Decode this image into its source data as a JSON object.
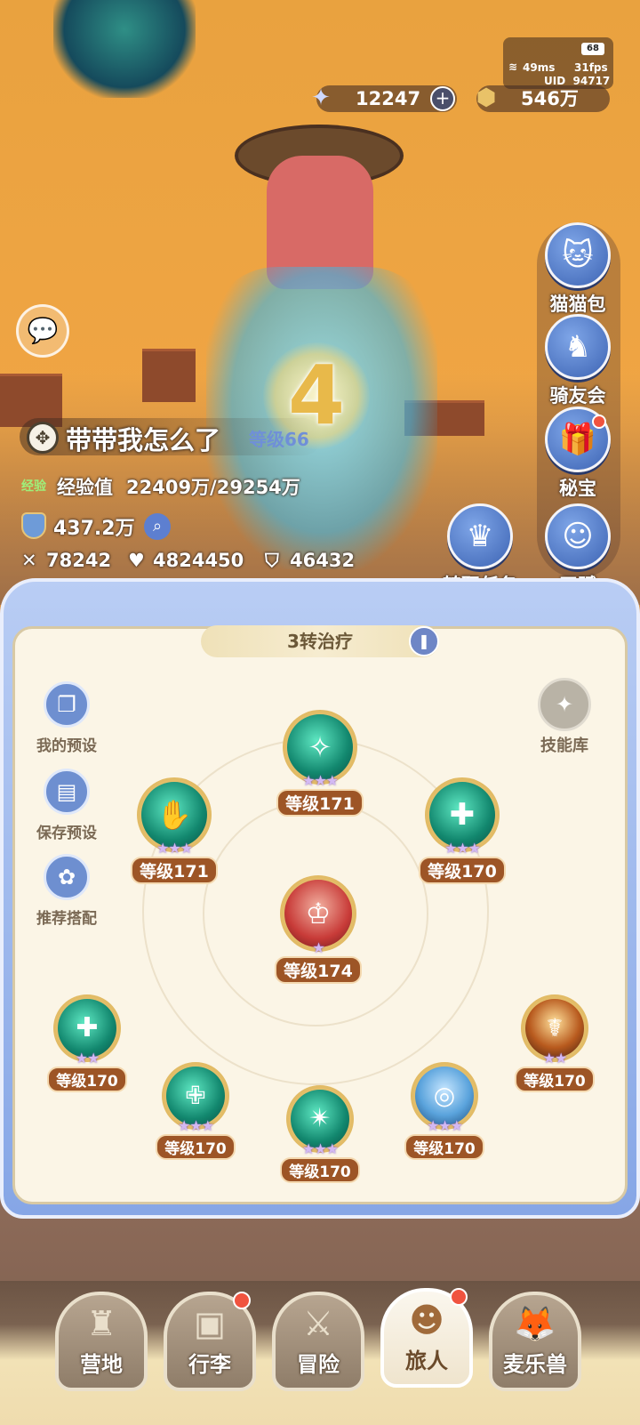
{
  "status": {
    "battery": "68",
    "ping": "49ms",
    "fps": "31fps",
    "uid": "UID  94717"
  },
  "currency": {
    "gems": "12247",
    "gold": "546万"
  },
  "side_menu": [
    {
      "label": "猫猫包",
      "icon": "cat-bag-icon",
      "glyph": "🐱"
    },
    {
      "label": "骑友会",
      "icon": "horse-icon",
      "glyph": "♞"
    },
    {
      "label": "秘宝",
      "icon": "treasure-icon",
      "glyph": "🎁"
    },
    {
      "label": "天赋",
      "icon": "brain-icon",
      "glyph": "☺"
    }
  ],
  "job_task": {
    "label": "转职任务",
    "glyph": "♛"
  },
  "player": {
    "name": "带带我怎么了",
    "level": "等级66",
    "exp_tag": "经验",
    "exp_label": "经验值",
    "exp_value": "22409万/29254万",
    "power": "437.2万",
    "attack": "78242",
    "hp": "4824450",
    "defense": "46432"
  },
  "countdown": "4",
  "panel": {
    "title": "3转治疗",
    "tools": [
      {
        "label": "我的预设",
        "icon": "preset-icon",
        "glyph": "❐"
      },
      {
        "label": "保存预设",
        "icon": "save-icon",
        "glyph": "▤"
      },
      {
        "label": "推荐搭配",
        "icon": "recommend-icon",
        "glyph": "✿"
      }
    ],
    "skill_library": "技能库",
    "skills": [
      {
        "level": "等级171",
        "stars": "★★★"
      },
      {
        "level": "等级171",
        "stars": "★★★"
      },
      {
        "level": "等级170",
        "stars": "★★★"
      },
      {
        "level": "等级174",
        "stars": "★"
      },
      {
        "level": "等级170",
        "stars": "★★"
      },
      {
        "level": "等级170",
        "stars": "★★★"
      },
      {
        "level": "等级170",
        "stars": "★★★"
      },
      {
        "level": "等级170",
        "stars": "★★★"
      },
      {
        "level": "等级170",
        "stars": "★★"
      }
    ]
  },
  "nav": [
    {
      "label": "营地",
      "glyph": "♜"
    },
    {
      "label": "行李",
      "glyph": "▣"
    },
    {
      "label": "冒险",
      "glyph": "⚔"
    },
    {
      "label": "旅人",
      "glyph": "☻"
    },
    {
      "label": "麦乐兽",
      "glyph": "🦊"
    }
  ],
  "colors": {
    "accent_blue": "#6e8fd0",
    "level_badge": "#9d5526",
    "panel_bg": "#fbf5e6",
    "alert_red": "#f0533f"
  }
}
